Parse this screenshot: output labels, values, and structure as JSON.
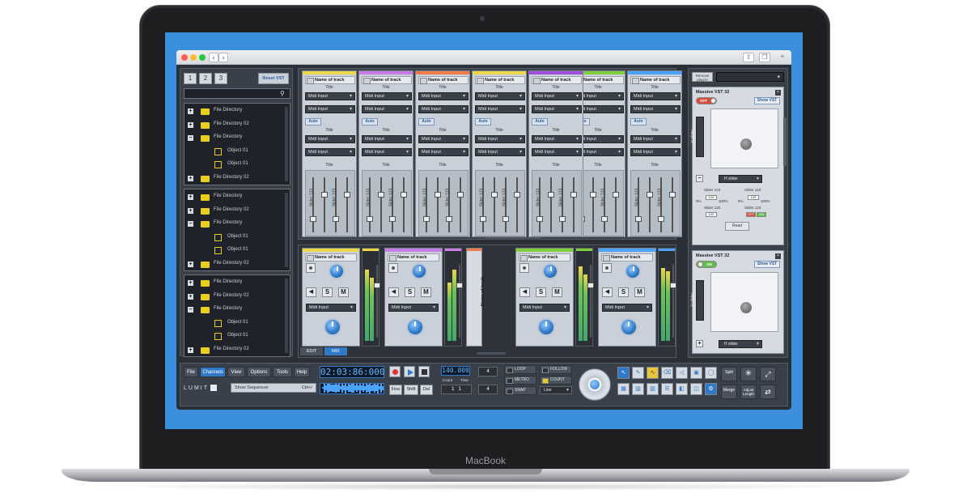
{
  "device": {
    "brand_label": "MacBook"
  },
  "left_panel": {
    "presets": [
      "1",
      "2",
      "3"
    ],
    "reset_label": "Reset VST",
    "search_placeholder": "",
    "groups": [
      [
        {
          "type": "folder",
          "label": "File Directory",
          "expander": "+"
        },
        {
          "type": "folder",
          "label": "File Directory 02",
          "expander": "+"
        },
        {
          "type": "folder",
          "label": "File Directory",
          "expander": "−"
        },
        {
          "type": "object",
          "label": "Object 01"
        },
        {
          "type": "object",
          "label": "Object 01"
        },
        {
          "type": "folder",
          "label": "File Directory 02",
          "expander": "+"
        }
      ],
      [
        {
          "type": "folder",
          "label": "File Directory",
          "expander": "+"
        },
        {
          "type": "folder",
          "label": "File Directory 02",
          "expander": "+"
        },
        {
          "type": "folder",
          "label": "File Directory",
          "expander": "−"
        },
        {
          "type": "object",
          "label": "Object 01"
        },
        {
          "type": "object",
          "label": "Object 01"
        },
        {
          "type": "folder",
          "label": "File Directory 02",
          "expander": "+"
        }
      ],
      [
        {
          "type": "folder",
          "label": "File Directory",
          "expander": "+"
        },
        {
          "type": "folder",
          "label": "File Directory 02",
          "expander": "+"
        },
        {
          "type": "folder",
          "label": "File Directory",
          "expander": "−"
        },
        {
          "type": "object",
          "label": "Object 01"
        },
        {
          "type": "object",
          "label": "Object 01"
        },
        {
          "type": "folder",
          "label": "File Directory 02",
          "expander": "+"
        }
      ]
    ]
  },
  "mixer": {
    "tracks": [
      {
        "name": "Name of track",
        "color": "#e8d84a"
      },
      {
        "name": "Name of track",
        "color": "#c77de6"
      },
      {
        "name": "Name of track",
        "color": "#f07a4a"
      },
      {
        "name": "Name of track",
        "color": "#e8d84a"
      },
      {
        "name": "Name of track",
        "color": "#a24be0"
      },
      {
        "name": "Name of track",
        "color": "#7fcf3a"
      },
      {
        "name": "Name of track",
        "color": "#4aa3ff"
      }
    ],
    "title_label": "Title",
    "midi_input_label": "Midi Input",
    "auto_label": "Auto",
    "fader_label": "Slider 123"
  },
  "channels": {
    "strips": [
      {
        "name": "Name of track",
        "color": "#e8d84a"
      },
      {
        "name": "Name of track",
        "color": "#c77de6"
      },
      {
        "name": "Name of track",
        "color": "#7fcf3a"
      },
      {
        "name": "Name of track",
        "color": "#4aa3ff"
      }
    ],
    "vertical_track": {
      "name": "Name of track",
      "color": "#f07a4a"
    },
    "midi_input_label": "Midi Input",
    "speaker_glyph": "◀",
    "solo_label": "S",
    "mute_label": "M",
    "edit_tab": "EDIT",
    "mix_tab": "MIX",
    "meter_levels": [
      0.88,
      0.78,
      0.72,
      0.88,
      0.92,
      0.82,
      0.9,
      0.86
    ]
  },
  "vst_panel": {
    "remove_label": "Remove plug-in",
    "plugins": [
      {
        "title": "Massive VST 32",
        "toggle": "OFF",
        "show_label": "Show VST",
        "v_slider": "V slider",
        "h_slider": "H slider",
        "sliders": [
          {
            "label": "Slider 123",
            "value": "120",
            "min": "0%",
            "max": "100%"
          },
          {
            "label": "Slider 123",
            "value": "120",
            "min": "0%",
            "max": "100%"
          },
          {
            "label": "Slider 123",
            "value": "120",
            "min": "",
            "max": ""
          },
          {
            "label": "Slider 123",
            "value": "",
            "min": "",
            "max": ""
          }
        ],
        "off_on": [
          "OFF",
          "ON"
        ],
        "read_label": "Read"
      },
      {
        "title": "Massive VST 32",
        "toggle": "ON",
        "show_label": "Show VST",
        "v_slider": "V slider",
        "h_slider": "H slider"
      }
    ]
  },
  "toolbar": {
    "menu": [
      "File",
      "Channels",
      "View",
      "Options",
      "Tools",
      "Help"
    ],
    "active_menu": "Channels",
    "logo": "LUMIT",
    "show_sequencer": "Show Sequencer",
    "shortcut": "Ctrl+/",
    "time": "02:03:86:000",
    "bpm": "140.000",
    "count_label": "Count",
    "time_label": "Time",
    "nums": {
      "top": "4",
      "bottom": "4",
      "count": "1",
      "time": "1"
    },
    "edit_buttons": [
      "Fine",
      "Shift",
      "Del"
    ],
    "options": [
      "LOOP",
      "FOLLOW",
      "METRO",
      "COUNT",
      "SNAP"
    ],
    "snap_mode": "Line",
    "actions": [
      "Split",
      "Merge",
      "Adjust Length"
    ]
  }
}
